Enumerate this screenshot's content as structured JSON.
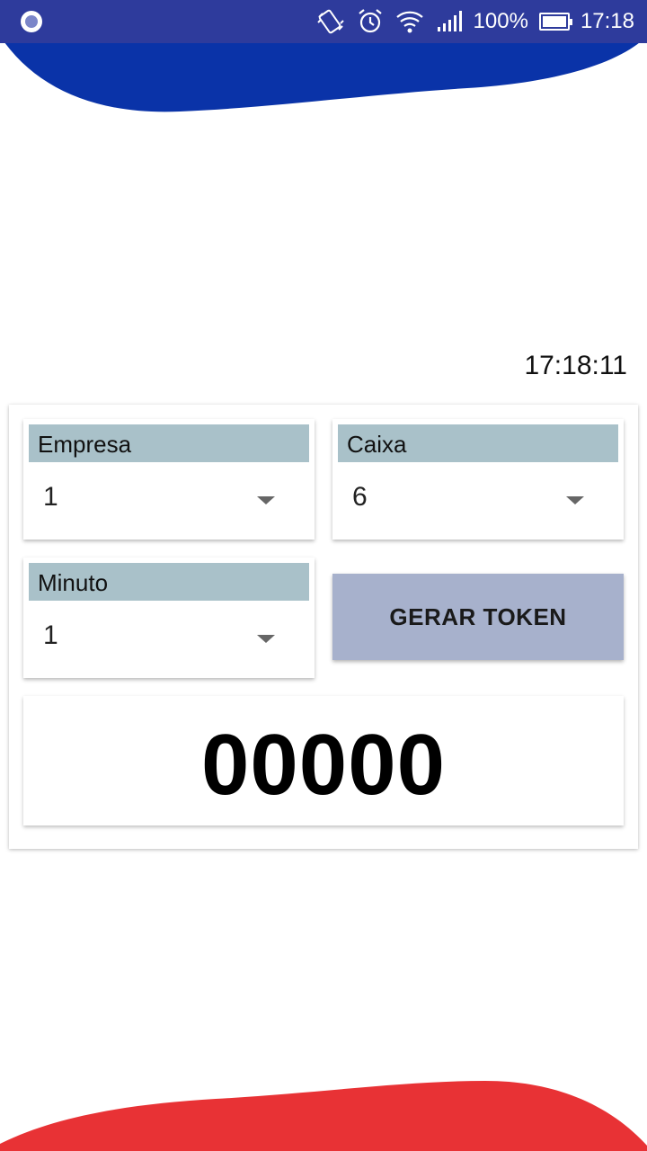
{
  "status_bar": {
    "battery": "100%",
    "time": "17:18",
    "icons": [
      "app-notification-icon",
      "vibrate-icon",
      "alarm-icon",
      "wifi-icon",
      "signal-icon",
      "battery-icon"
    ]
  },
  "clock": "17:18:11",
  "form": {
    "empresa": {
      "label": "Empresa",
      "value": "1"
    },
    "caixa": {
      "label": "Caixa",
      "value": "6"
    },
    "minuto": {
      "label": "Minuto",
      "value": "1"
    },
    "generate_button": "GERAR TOKEN"
  },
  "token": "00000",
  "colors": {
    "top_wave": "#0a33a8",
    "status_bar": "#2e3b9c",
    "bottom_wave": "#e83235",
    "label_bg": "#a9c1c9",
    "button_bg": "#a7b1cc"
  }
}
